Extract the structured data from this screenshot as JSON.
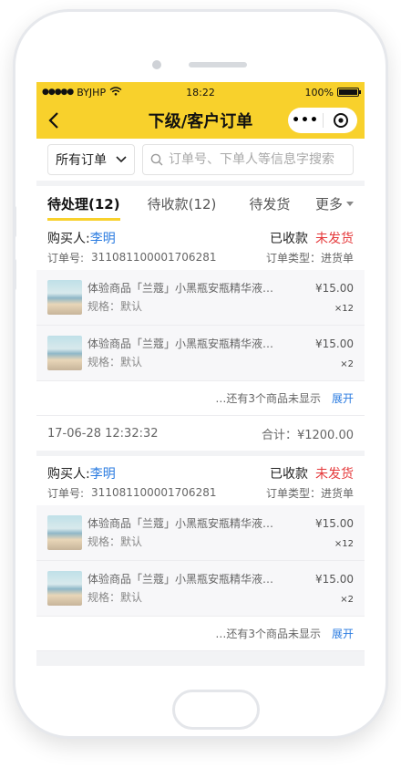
{
  "status_bar": {
    "carrier": "BYJHP",
    "time": "18:22",
    "battery": "100%"
  },
  "nav": {
    "title": "下级/客户订单",
    "more_icon": "ellipsis-icon",
    "close_icon": "target-circle-icon"
  },
  "filter": {
    "selected": "所有订单",
    "search_placeholder": "订单号、下单人等信息字搜索"
  },
  "tabs": [
    {
      "label": "待处理(12)",
      "active": true
    },
    {
      "label": "待收款(12)",
      "active": false
    },
    {
      "label": "待发货",
      "active": false
    }
  ],
  "tabs_more": "更多",
  "orders": [
    {
      "buyer_label": "购买人:",
      "buyer_name": "李明",
      "paid_status": "已收款",
      "ship_status": "未发货",
      "order_no_label": "订单号:",
      "order_no": "311081100001706281",
      "order_type": "订单类型：进货单",
      "items": [
        {
          "name": "体验商品「兰蔻」小黑瓶安瓶精华液…",
          "spec": "规格：默认",
          "price": "¥15.00",
          "qty": "×12"
        },
        {
          "name": "体验商品「兰蔻」小黑瓶安瓶精华液…",
          "spec": "规格：默认",
          "price": "¥15.00",
          "qty": "×2"
        }
      ],
      "more_text": "…还有3个商品未显示",
      "expand_label": "展开",
      "date": "17-06-28  12:32:32",
      "total": "合计：¥1200.00"
    },
    {
      "buyer_label": "购买人:",
      "buyer_name": "李明",
      "paid_status": "已收款",
      "ship_status": "未发货",
      "order_no_label": "订单号:",
      "order_no": "311081100001706281",
      "order_type": "订单类型：进货单",
      "items": [
        {
          "name": "体验商品「兰蔻」小黑瓶安瓶精华液…",
          "spec": "规格：默认",
          "price": "¥15.00",
          "qty": "×12"
        },
        {
          "name": "体验商品「兰蔻」小黑瓶安瓶精华液…",
          "spec": "规格：默认",
          "price": "¥15.00",
          "qty": "×2"
        }
      ],
      "more_text": "…还有3个商品未显示",
      "expand_label": "展开"
    }
  ],
  "colors": {
    "brand_yellow": "#f8d12c",
    "link_blue": "#2a7be0",
    "alert_red": "#e5393b"
  }
}
